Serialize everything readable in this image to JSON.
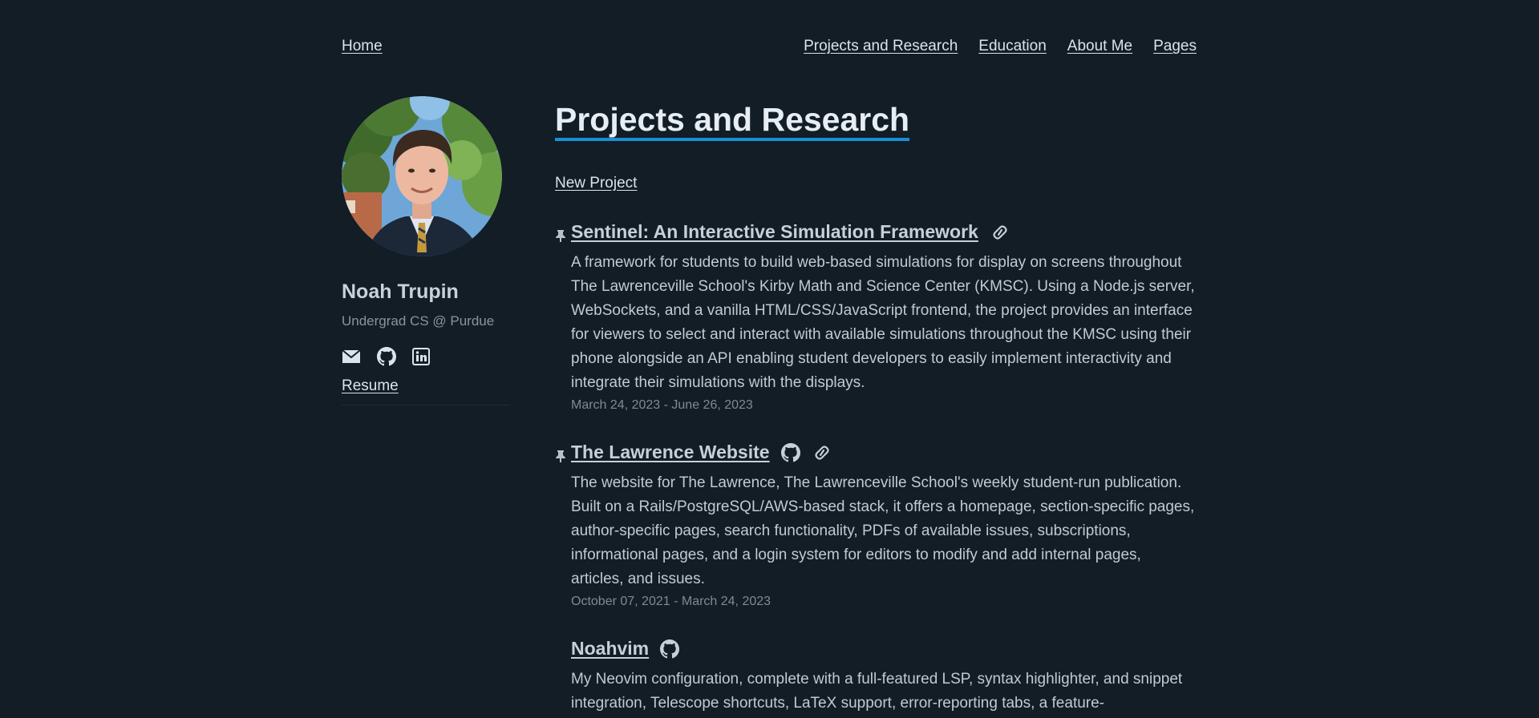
{
  "nav": {
    "home": "Home",
    "links": [
      "Projects and Research",
      "Education",
      "About Me",
      "Pages"
    ]
  },
  "sidebar": {
    "name": "Noah Trupin",
    "bio": "Undergrad CS @ Purdue",
    "social_icons": [
      "envelope-icon",
      "github-icon",
      "linkedin-icon"
    ],
    "resume": "Resume"
  },
  "main": {
    "title": "Projects and Research",
    "new_project": "New Project",
    "projects": [
      {
        "title": "Sentinel: An Interactive Simulation Framework",
        "pinned": true,
        "icons": [
          "link-icon"
        ],
        "description": "A framework for students to build web-based simulations for display on screens throughout The Lawrenceville School's Kirby Math and Science Center (KMSC). Using a Node.js server, WebSockets, and a vanilla HTML/CSS/JavaScript frontend, the project provides an interface for viewers to select and interact with available simulations throughout the KMSC using their phone alongside an API enabling student developers to easily implement interactivity and integrate their simulations with the displays.",
        "date": "March 24, 2023 - June 26, 2023"
      },
      {
        "title": "The Lawrence Website",
        "pinned": true,
        "icons": [
          "github-icon",
          "link-icon"
        ],
        "description": "The website for The Lawrence, The Lawrenceville School's weekly student-run publication. Built on a Rails/PostgreSQL/AWS-based stack, it offers a homepage, section-specific pages, author-specific pages, search functionality, PDFs of available issues, subscriptions, informational pages, and a login system for editors to modify and add internal pages, articles, and issues.",
        "date": "October 07, 2021 - March 24, 2023"
      },
      {
        "title": "Noahvim",
        "pinned": false,
        "icons": [
          "github-icon"
        ],
        "description": "My Neovim configuration, complete with a full-featured LSP, syntax highlighter, and snippet integration, Telescope shortcuts, LaTeX support, error-reporting tabs, a feature-",
        "date": ""
      }
    ]
  },
  "colors": {
    "background": "#121d25",
    "accent_underline": "#1a8fd6",
    "text": "#c2cad2",
    "muted": "#7f8a94"
  }
}
